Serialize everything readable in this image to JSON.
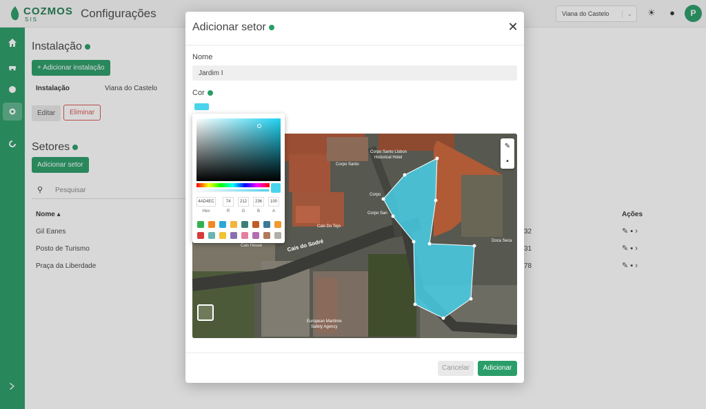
{
  "logo": {
    "name": "COZMOS",
    "sub": "SIS"
  },
  "header": {
    "title": "Configurações",
    "location": "Viana do Castelo",
    "avatar_letter": "P"
  },
  "background": {
    "installation_title": "Instalação",
    "add_installation_label": "+ Adicionar instalação",
    "installation_col": "Instalação",
    "installation_value": "Viana do Castelo",
    "edit_label": "Editar",
    "delete_label": "Eliminar",
    "sectors_title": "Setores",
    "add_sector_label": "Adicionar setor",
    "search_placeholder": "Pesquisar",
    "col_name": "Nome",
    "col_actions": "Ações",
    "rows": [
      {
        "name": "Gil Eanes",
        "num": "32"
      },
      {
        "name": "Posto de Turismo",
        "num": "31"
      },
      {
        "name": "Praça da Liberdade",
        "num": "78"
      }
    ]
  },
  "modal": {
    "title": "Adicionar setor",
    "name_label": "Nome",
    "name_value": "Jardim I",
    "color_label": "Cor",
    "cancel_label": "Cancelar",
    "add_label": "Adicionar",
    "selected_color": "#4ad4ec"
  },
  "picker": {
    "hex": "4AD4EC",
    "r": "74",
    "g": "212",
    "b": "236",
    "a": "100",
    "hex_label": "Hex",
    "r_label": "R",
    "g_label": "G",
    "b_label": "B",
    "a_label": "A",
    "swatches": [
      "#2fb24f",
      "#f08a24",
      "#2ba7d8",
      "#f2b43b",
      "#3a7f77",
      "#c05a26",
      "#3a7a9a",
      "#f39a2e",
      "#d83a3a",
      "#6cb5b0",
      "#f1c232",
      "#8a6fb0",
      "#e57f9c",
      "#b06fb0",
      "#b07a5a",
      "#b0b0a8"
    ]
  },
  "map_labels": [
    {
      "text": "Corpo Santo Lisbon"
    },
    {
      "text": "Historical Hotel"
    },
    {
      "text": "Corpo Santo"
    },
    {
      "text": "Corpo"
    },
    {
      "text": "Corpo San"
    },
    {
      "text": "Cais Do Tejo"
    },
    {
      "text": "Cais do Sodré"
    },
    {
      "text": "Cais House"
    },
    {
      "text": "Doca Seca"
    },
    {
      "text": "European Maritime"
    },
    {
      "text": "Safety Agency"
    }
  ]
}
